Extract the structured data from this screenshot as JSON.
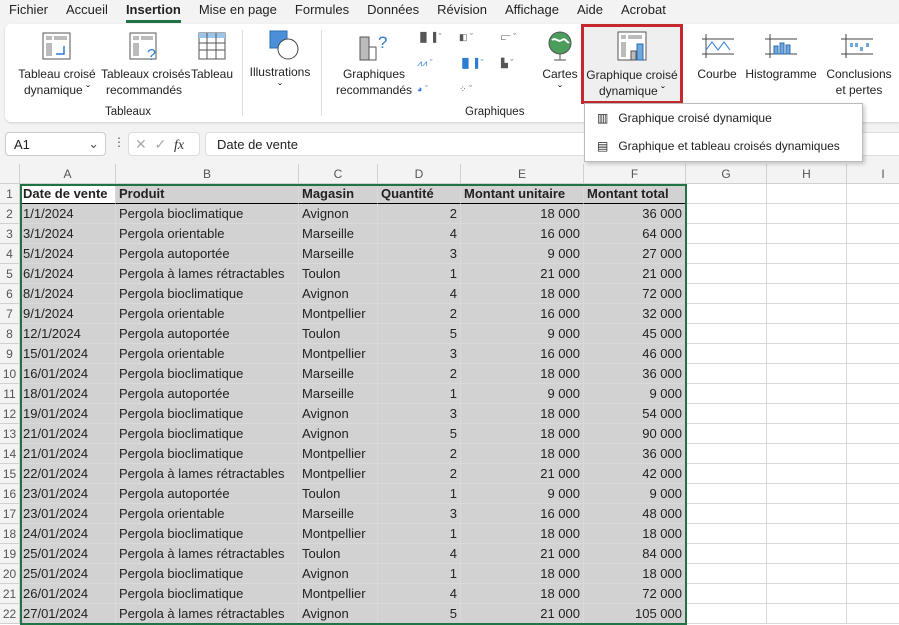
{
  "menu": [
    "Fichier",
    "Accueil",
    "Insertion",
    "Mise en page",
    "Formules",
    "Données",
    "Révision",
    "Affichage",
    "Aide",
    "Acrobat"
  ],
  "active_menu": "Insertion",
  "ribbon": {
    "pivot_table": "Tableau croisé\ndynamique ˇ",
    "recommended_pivots": "Tableaux croisés\nrecommandés",
    "table": "Tableau",
    "group_tables": "Tableaux",
    "illustrations": "Illustrations\nˇ",
    "recommended_charts": "Graphiques\nrecommandés",
    "group_charts": "Graphiques",
    "maps": "Cartes\nˇ",
    "pivot_chart": "Graphique croisé\ndynamique ˇ",
    "line": "Courbe",
    "column": "Histogramme",
    "winloss": "Conclusions\net pertes"
  },
  "dropdown": {
    "items": [
      "Graphique croisé dynamique",
      "Graphique et tableau croisés dynamiques"
    ]
  },
  "formula_bar": {
    "name_box": "A1",
    "fx": "fx",
    "value": "Date de vente"
  },
  "accent": "#217346",
  "highlight": "#c5282f",
  "columns": [
    "A",
    "B",
    "C",
    "D",
    "E",
    "F",
    "G",
    "H",
    "I"
  ],
  "headers": [
    "Date de vente",
    "Produit",
    "Magasin",
    "Quantité",
    "Montant unitaire",
    "Montant total"
  ],
  "rows": [
    [
      "1/1/2024",
      "Pergola bioclimatique",
      "Avignon",
      "2",
      "18 000",
      "36 000"
    ],
    [
      "3/1/2024",
      "Pergola orientable",
      "Marseille",
      "4",
      "16 000",
      "64 000"
    ],
    [
      "5/1/2024",
      "Pergola autoportée",
      "Marseille",
      "3",
      "9 000",
      "27 000"
    ],
    [
      "6/1/2024",
      "Pergola à lames rétractables",
      "Toulon",
      "1",
      "21 000",
      "21 000"
    ],
    [
      "8/1/2024",
      "Pergola bioclimatique",
      "Avignon",
      "4",
      "18 000",
      "72 000"
    ],
    [
      "9/1/2024",
      "Pergola orientable",
      "Montpellier",
      "2",
      "16 000",
      "32 000"
    ],
    [
      "12/1/2024",
      "Pergola autoportée",
      "Toulon",
      "5",
      "9 000",
      "45 000"
    ],
    [
      "15/01/2024",
      "Pergola orientable",
      "Montpellier",
      "3",
      "16 000",
      "46 000"
    ],
    [
      "16/01/2024",
      "Pergola bioclimatique",
      "Marseille",
      "2",
      "18 000",
      "36 000"
    ],
    [
      "18/01/2024",
      "Pergola autoportée",
      "Marseille",
      "1",
      "9 000",
      "9 000"
    ],
    [
      "19/01/2024",
      "Pergola bioclimatique",
      "Avignon",
      "3",
      "18 000",
      "54 000"
    ],
    [
      "21/01/2024",
      "Pergola bioclimatique",
      "Avignon",
      "5",
      "18 000",
      "90 000"
    ],
    [
      "21/01/2024",
      "Pergola bioclimatique",
      "Montpellier",
      "2",
      "18 000",
      "36 000"
    ],
    [
      "22/01/2024",
      "Pergola à lames rétractables",
      "Montpellier",
      "2",
      "21 000",
      "42 000"
    ],
    [
      "23/01/2024",
      "Pergola autoportée",
      "Toulon",
      "1",
      "9 000",
      "9 000"
    ],
    [
      "23/01/2024",
      "Pergola orientable",
      "Marseille",
      "3",
      "16 000",
      "48 000"
    ],
    [
      "24/01/2024",
      "Pergola bioclimatique",
      "Montpellier",
      "1",
      "18 000",
      "18 000"
    ],
    [
      "25/01/2024",
      "Pergola à lames rétractables",
      "Toulon",
      "4",
      "21 000",
      "84 000"
    ],
    [
      "25/01/2024",
      "Pergola bioclimatique",
      "Avignon",
      "1",
      "18 000",
      "18 000"
    ],
    [
      "26/01/2024",
      "Pergola bioclimatique",
      "Montpellier",
      "4",
      "18 000",
      "72 000"
    ],
    [
      "27/01/2024",
      "Pergola à lames rétractables",
      "Avignon",
      "5",
      "21 000",
      "105 000"
    ]
  ]
}
